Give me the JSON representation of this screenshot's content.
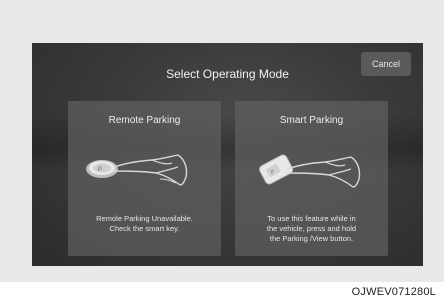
{
  "dialog": {
    "title": "Select Operating Mode",
    "cancel_label": "Cancel"
  },
  "options": [
    {
      "title": "Remote Parking",
      "description_line1": "Remole Parking Unavailable.",
      "description_line2": "Check the smart key.",
      "icon": "finger-pressing-button-icon"
    },
    {
      "title": "Smart Parking",
      "description_line1": "To use this feature while in",
      "description_line2": "the vehicle, press and hold",
      "description_line3": "the Parking /View button.",
      "icon": "finger-pressing-key-icon"
    }
  ],
  "figure_code": "OJWEV071280L"
}
